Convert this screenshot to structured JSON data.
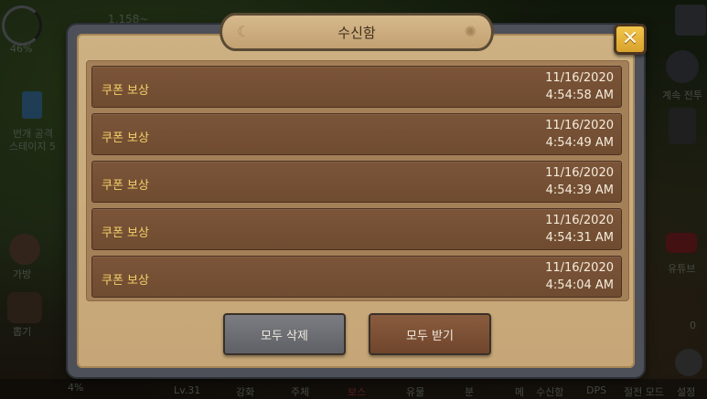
{
  "hud": {
    "hp_percent": "46%",
    "gold_partial": "1,158~",
    "skill_label_1": "번개 공격",
    "skill_label_2": "스테이지 5",
    "left_bag_label": "가방",
    "left_pet_label": "뽑기",
    "right_label_1": "계속 전투",
    "right_youtube": "유튜브",
    "right_zero": "0",
    "bottom_percent": "4%",
    "bottom_tabs": [
      "Lv.31",
      "강화",
      "주체",
      "보스",
      "유물",
      "분",
      "메",
      "수신함",
      "DPS",
      "절전 모드",
      "설정"
    ]
  },
  "inbox": {
    "title": "수신함",
    "close_label": "✕",
    "messages": [
      {
        "title": "쿠폰 보상",
        "date": "11/16/2020",
        "time": "4:54:58 AM"
      },
      {
        "title": "쿠폰 보상",
        "date": "11/16/2020",
        "time": "4:54:49 AM"
      },
      {
        "title": "쿠폰 보상",
        "date": "11/16/2020",
        "time": "4:54:39 AM"
      },
      {
        "title": "쿠폰 보상",
        "date": "11/16/2020",
        "time": "4:54:31 AM"
      },
      {
        "title": "쿠폰 보상",
        "date": "11/16/2020",
        "time": "4:54:04 AM"
      }
    ],
    "delete_all_label": "모두 삭제",
    "receive_all_label": "모두 받기"
  },
  "colors": {
    "row_title": "#f3d06a",
    "close_button": "#e6b33b"
  }
}
